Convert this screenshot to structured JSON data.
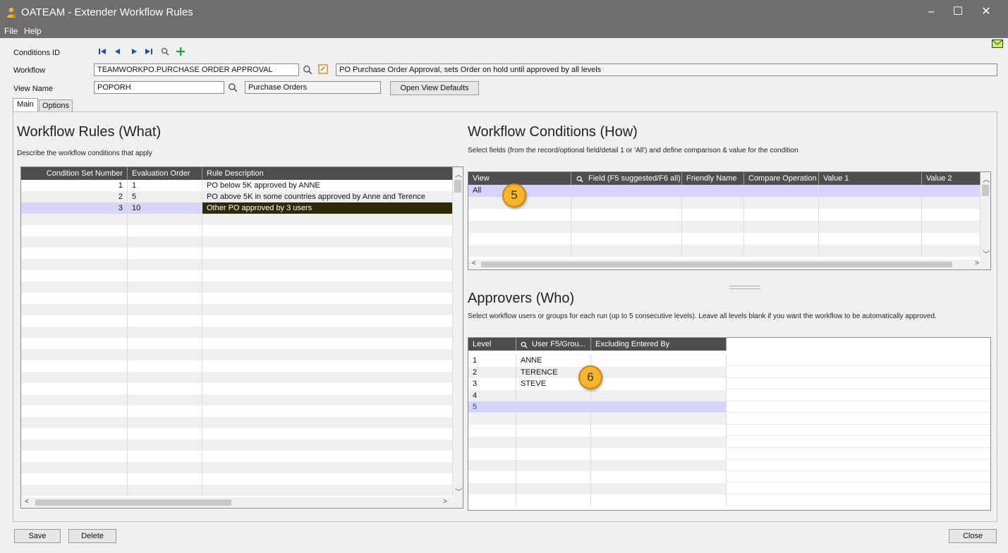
{
  "window": {
    "title": "OATEAM - Extender Workflow Rules",
    "controls": {
      "minimize": "–",
      "maximize": "☐",
      "close": "✕"
    }
  },
  "menu": [
    "File",
    "Help"
  ],
  "header": {
    "conditions_id_label": "Conditions ID",
    "workflow_label": "Workflow",
    "workflow_value": "TEAMWORKPO.PURCHASE ORDER APPROVAL",
    "workflow_description": "PO Purchase Order Approval, sets Order on hold until approved by all levels",
    "view_name_label": "View Name",
    "view_name_value": "POPORH",
    "view_description": "Purchase Orders",
    "open_view_defaults_label": "Open View Defaults"
  },
  "tabs": [
    "Main",
    "Options"
  ],
  "rules": {
    "title": "Workflow Rules (What)",
    "description": "Describe the workflow conditions that apply",
    "columns": [
      "Condition Set Number",
      "Evaluation Order",
      "Rule Description"
    ],
    "rows": [
      {
        "set": "1",
        "order": "1",
        "desc": "PO below 5K approved by ANNE"
      },
      {
        "set": "2",
        "order": "5",
        "desc": "PO above 5K in some countries approved by Anne and Terence"
      },
      {
        "set": "3",
        "order": "10",
        "desc": "Other PO approved by 3 users"
      }
    ],
    "selected_row": 2
  },
  "conditions": {
    "title": "Workflow Conditions (How)",
    "description": "Select fields (from the record/optional field/detail 1 or 'All') and define comparison & value for the condition",
    "columns": [
      "View",
      "Field (F5 suggested/F6 all)",
      "Friendly Name",
      "Compare Operation",
      "Value 1",
      "Value 2"
    ],
    "rows": [
      {
        "view": "All"
      }
    ]
  },
  "approvers": {
    "title": "Approvers (Who)",
    "description": "Select workflow users or groups for each run (up to 5 consecutive levels). Leave all levels blank if you want the workflow to be automatically approved.",
    "columns": [
      "Level",
      "User F5/Grou...",
      "Excluding Entered By"
    ],
    "rows": [
      {
        "level": "1",
        "user": "ANNE"
      },
      {
        "level": "2",
        "user": "TERENCE"
      },
      {
        "level": "3",
        "user": "STEVE"
      },
      {
        "level": "4",
        "user": ""
      },
      {
        "level": "5",
        "user": ""
      }
    ]
  },
  "callouts": [
    "5",
    "6"
  ],
  "footer": {
    "save_label": "Save",
    "delete_label": "Delete",
    "close_label": "Close"
  },
  "colors": {
    "titlebar": "#6e6e6e",
    "grid_header": "#4e4e4e",
    "selection": "#d6d4fb",
    "highlight": "#2e2a06",
    "callout": "#f7b52b",
    "plus": "#22a83a",
    "nav": "#1f4fa8"
  }
}
